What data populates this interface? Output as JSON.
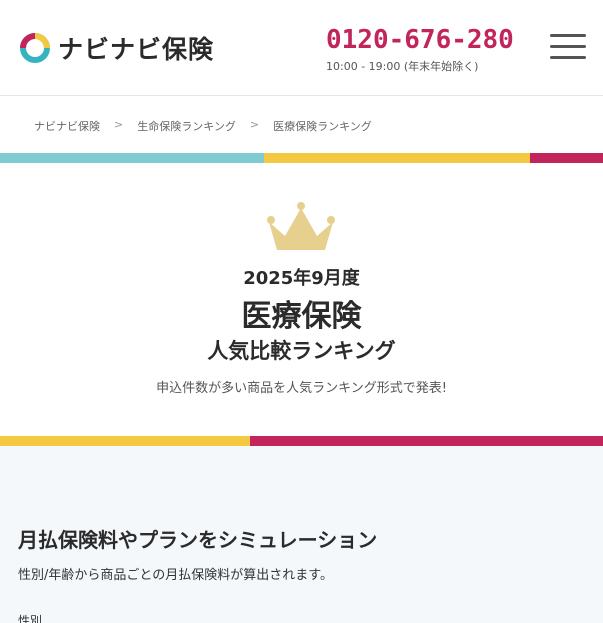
{
  "header": {
    "logo_text": "ナビナビ保険",
    "phone": "0120-676-280",
    "hours": "10:00 - 19:00 (年末年始除く)",
    "menu_icon": "hamburger-menu-icon",
    "phone_color": "#c2255c"
  },
  "breadcrumb": {
    "items": [
      "ナビナビ保険",
      "生命保険ランキング",
      "医療保険ランキング"
    ],
    "separator": ">"
  },
  "hero": {
    "date": "2025年9月度",
    "title": "医療保険",
    "subtitle": "人気比較ランキング",
    "description": "申込件数が多い商品を人気ランキング形式で発表!",
    "crown_icon": "crown-icon",
    "crown_color": "#e7cf8e"
  },
  "stripe_colors": {
    "teal": "#7ecbd2",
    "yellow": "#f5c842",
    "magenta": "#c2255c"
  },
  "simulation": {
    "title": "月払保険料やプランをシミュレーション",
    "description": "性別/年齢から商品ごとの月払保険料が算出されます。",
    "field_label": "性別",
    "field_value": ""
  }
}
